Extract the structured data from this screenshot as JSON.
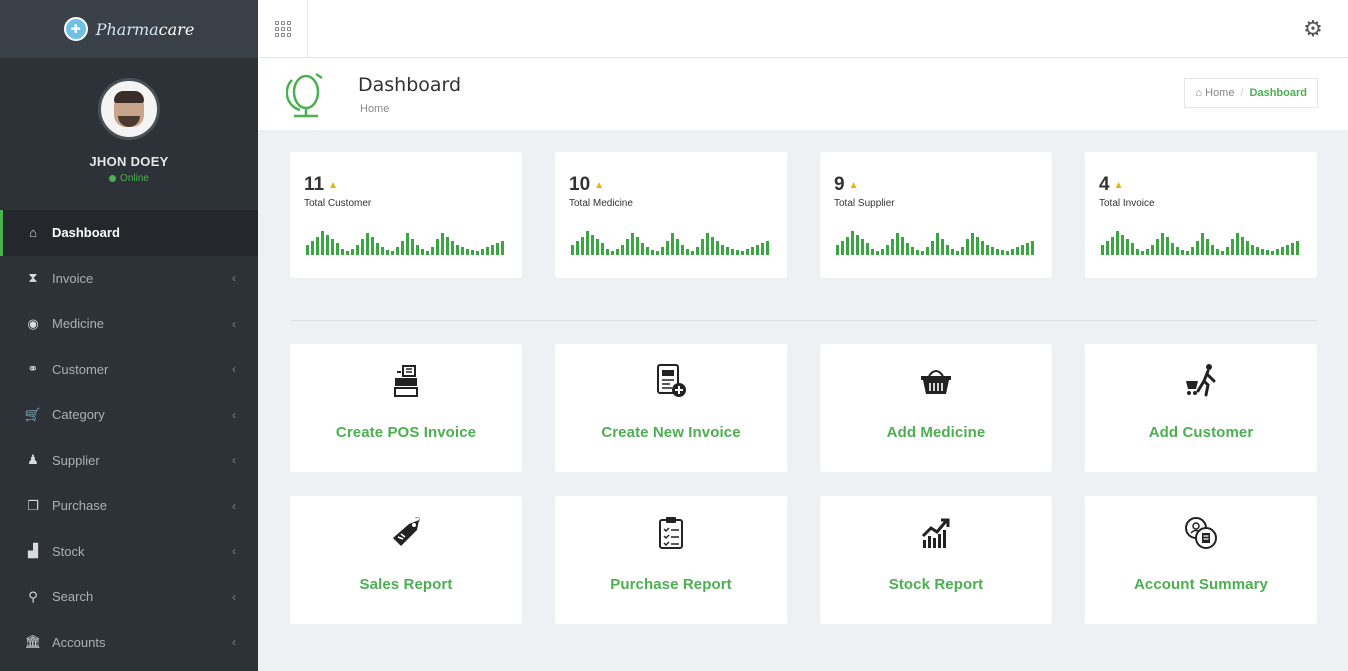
{
  "brand": {
    "name_italic": "Pharma",
    "name_tail": "care"
  },
  "user": {
    "name": "JHON DOEY",
    "status": "Online"
  },
  "sidebar": {
    "items": [
      {
        "label": "Dashboard",
        "icon": "home-icon",
        "glyph": "⌂",
        "active": true
      },
      {
        "label": "Invoice",
        "icon": "hourglass-icon",
        "glyph": "⧗"
      },
      {
        "label": "Medicine",
        "icon": "pill-icon",
        "glyph": "◉"
      },
      {
        "label": "Customer",
        "icon": "handshake-icon",
        "glyph": "⚭"
      },
      {
        "label": "Category",
        "icon": "cart-icon",
        "glyph": "🛒"
      },
      {
        "label": "Supplier",
        "icon": "person-icon",
        "glyph": "♟"
      },
      {
        "label": "Purchase",
        "icon": "purchase-icon",
        "glyph": "❐"
      },
      {
        "label": "Stock",
        "icon": "bar-chart-icon",
        "glyph": "▟"
      },
      {
        "label": "Search",
        "icon": "search-icon",
        "glyph": "⚲"
      },
      {
        "label": "Accounts",
        "icon": "bank-icon",
        "glyph": "🏛"
      }
    ],
    "chevron": "‹"
  },
  "header": {
    "title": "Dashboard",
    "subtitle": "Home"
  },
  "breadcrumb": {
    "home": "Home",
    "separator": "/",
    "current": "Dashboard"
  },
  "stats": [
    {
      "value": "11",
      "label": "Total Customer"
    },
    {
      "value": "10",
      "label": "Total Medicine"
    },
    {
      "value": "9",
      "label": "Total Supplier"
    },
    {
      "value": "4",
      "label": "Total Invoice"
    }
  ],
  "actions": [
    {
      "label": "Create POS Invoice",
      "icon": "pos-register-icon"
    },
    {
      "label": "Create New Invoice",
      "icon": "new-invoice-icon"
    },
    {
      "label": "Add Medicine",
      "icon": "basket-icon"
    },
    {
      "label": "Add Customer",
      "icon": "shopper-cart-icon"
    },
    {
      "label": "Sales Report",
      "icon": "sale-tag-icon"
    },
    {
      "label": "Purchase Report",
      "icon": "clipboard-list-icon"
    },
    {
      "label": "Stock Report",
      "icon": "stock-growth-icon"
    },
    {
      "label": "Account Summary",
      "icon": "account-coins-icon"
    }
  ],
  "colors": {
    "accent": "#4caf50",
    "sidebar": "#2d3238",
    "arrow": "#f0b400"
  }
}
